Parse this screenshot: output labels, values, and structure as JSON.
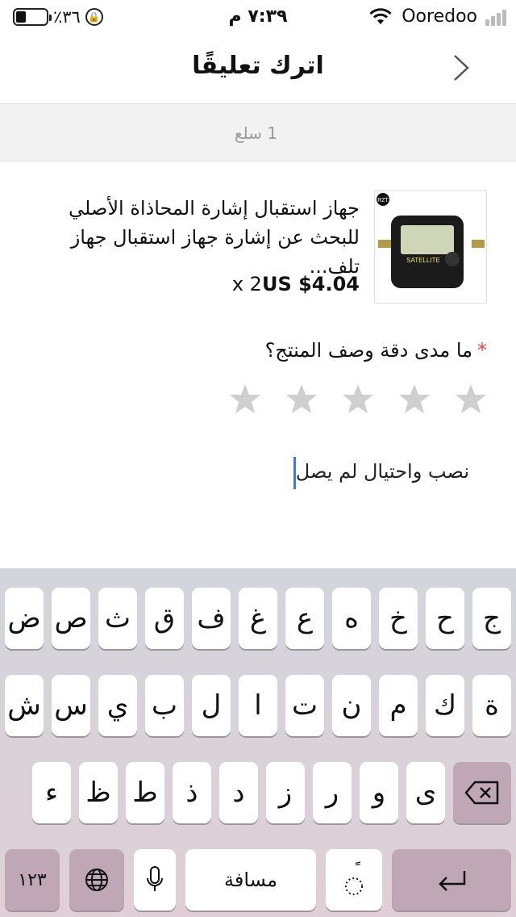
{
  "status_bar": {
    "battery_percent": "٪٣٦",
    "time": "٧:٣٩ م",
    "carrier": "Ooredoo"
  },
  "nav": {
    "title": "اترك تعليقًا"
  },
  "order_strip": {
    "item_count": "1 سلع"
  },
  "product": {
    "title": "جهاز استقبال إشارة المحاذاة الأصلي للبحث عن إشارة جهاز استقبال جهاز تلف...",
    "price": "US $4.04",
    "quantity": "x 2",
    "thumb_label": "SATELLITE",
    "badge": "RZT"
  },
  "rating": {
    "required_mark": "*",
    "question": "ما مدى دقة وصف المنتج؟",
    "value": 0,
    "max": 5
  },
  "comment": {
    "text": "نصب واحتيال لم يصل"
  },
  "keyboard": {
    "row1": [
      "ج",
      "ح",
      "خ",
      "ه",
      "ع",
      "غ",
      "ف",
      "ق",
      "ث",
      "ص",
      "ض"
    ],
    "row2": [
      "ة",
      "ك",
      "م",
      "ن",
      "ت",
      "ا",
      "ل",
      "ب",
      "ي",
      "س",
      "ش"
    ],
    "row3": [
      "ى",
      "و",
      "ر",
      "ز",
      "د",
      "ذ",
      "ط",
      "ظ",
      "ء"
    ],
    "numbers_label": "١٢٣",
    "space_label": "مسافة",
    "diacritic_label": "ًً"
  },
  "colors": {
    "required": "#e34c4c",
    "star_empty": "#cfcfcf",
    "caret": "#3978f0"
  }
}
